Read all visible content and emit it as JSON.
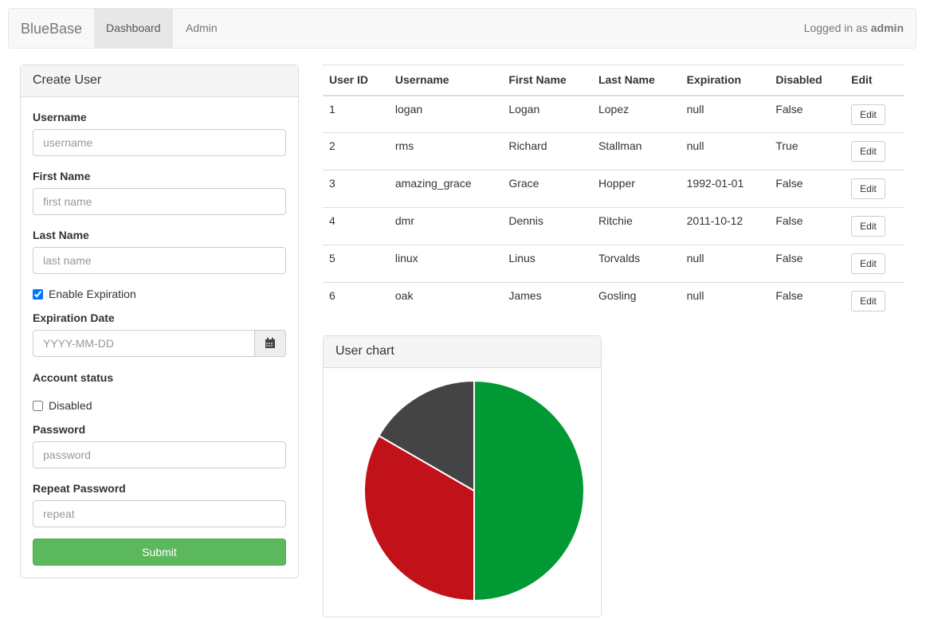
{
  "navbar": {
    "brand": "BlueBase",
    "links": [
      {
        "label": "Dashboard",
        "active": true
      },
      {
        "label": "Admin",
        "active": false
      }
    ],
    "logged_prefix": "Logged in as",
    "user": "admin"
  },
  "form": {
    "title": "Create User",
    "username": {
      "label": "Username",
      "placeholder": "username",
      "value": ""
    },
    "first_name": {
      "label": "First Name",
      "placeholder": "first name",
      "value": ""
    },
    "last_name": {
      "label": "Last Name",
      "placeholder": "last name",
      "value": ""
    },
    "enable_expiration": {
      "label": "Enable Expiration",
      "checked": true
    },
    "expiration": {
      "label": "Expiration Date",
      "placeholder": "YYYY-MM-DD",
      "icon": "calendar-icon"
    },
    "account_status": {
      "label": "Account status"
    },
    "disabled": {
      "label": "Disabled",
      "checked": false
    },
    "password": {
      "label": "Password",
      "placeholder": "password"
    },
    "repeat": {
      "label": "Repeat Password",
      "placeholder": "repeat"
    },
    "submit": "Submit"
  },
  "table": {
    "headers": [
      "User ID",
      "Username",
      "First Name",
      "Last Name",
      "Expiration",
      "Disabled",
      "Edit"
    ],
    "rows": [
      [
        "1",
        "logan",
        "Logan",
        "Lopez",
        "null",
        "False"
      ],
      [
        "2",
        "rms",
        "Richard",
        "Stallman",
        "null",
        "True"
      ],
      [
        "3",
        "amazing_grace",
        "Grace",
        "Hopper",
        "1992-01-01",
        "False"
      ],
      [
        "4",
        "dmr",
        "Dennis",
        "Ritchie",
        "2011-10-12",
        "False"
      ],
      [
        "5",
        "linux",
        "Linus",
        "Torvalds",
        "null",
        "False"
      ],
      [
        "6",
        "oak",
        "James",
        "Gosling",
        "null",
        "False"
      ]
    ],
    "edit_label": "Edit"
  },
  "chart_panel": {
    "title": "User chart"
  },
  "chart_data": {
    "type": "pie",
    "values": [
      3,
      2,
      1
    ],
    "colors": [
      "#009933",
      "#c1121a",
      "#444444"
    ]
  }
}
